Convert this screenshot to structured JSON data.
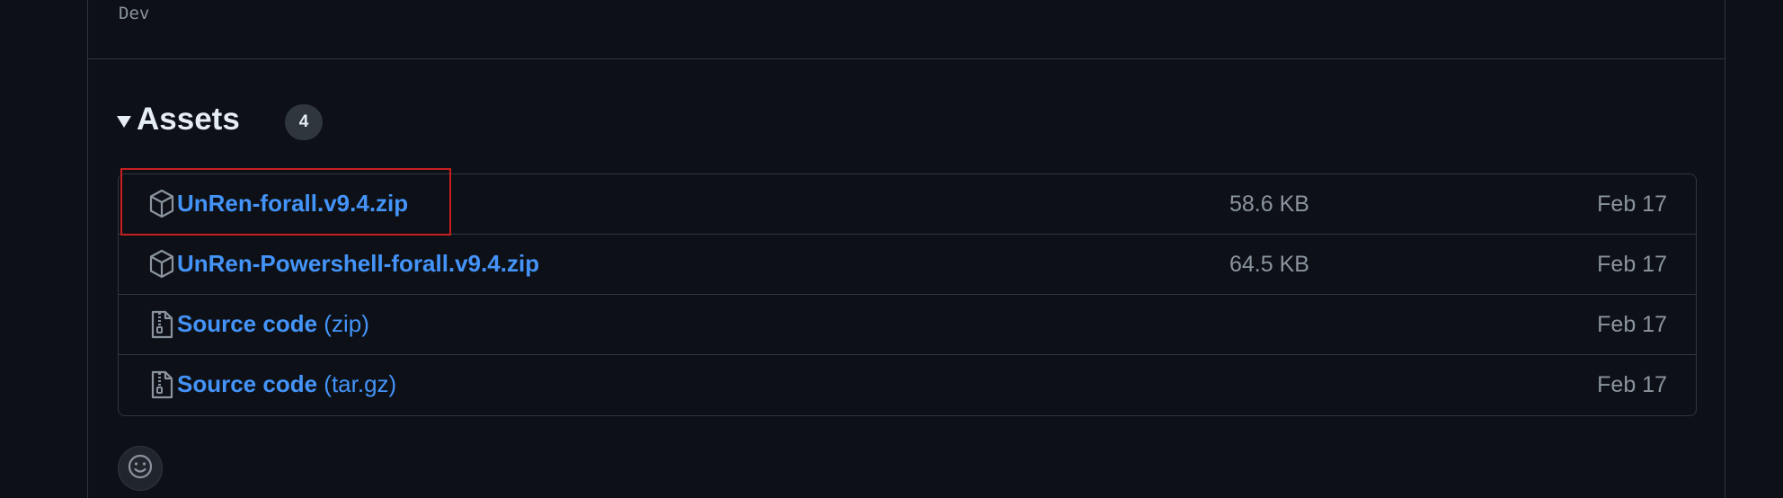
{
  "release": {
    "tag_label": "Dev"
  },
  "assets": {
    "title": "Assets",
    "count": "4",
    "items": [
      {
        "name": "UnRen-forall.v9.4.zip",
        "ext": "",
        "size": "58.6 KB",
        "date": "Feb 17",
        "icon": "package-icon"
      },
      {
        "name": "UnRen-Powershell-forall.v9.4.zip",
        "ext": "",
        "size": "64.5 KB",
        "date": "Feb 17",
        "icon": "package-icon"
      },
      {
        "name": "Source code",
        "ext": "(zip)",
        "size": "",
        "date": "Feb 17",
        "icon": "file-zip-icon"
      },
      {
        "name": "Source code",
        "ext": "(tar.gz)",
        "size": "",
        "date": "Feb 17",
        "icon": "file-zip-icon"
      }
    ]
  },
  "reactions": {
    "icon": "smiley-icon"
  },
  "colors": {
    "background": "#0d1117",
    "border": "#30363d",
    "link": "#4493f8",
    "muted": "#8b949e",
    "highlight": "#c81e1e"
  }
}
